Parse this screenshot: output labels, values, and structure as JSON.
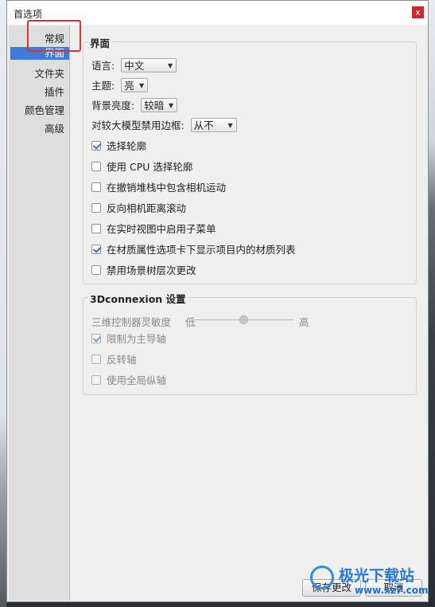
{
  "window": {
    "title": "首选项",
    "close_label": "x"
  },
  "sidebar": {
    "items": [
      {
        "label": "常规"
      },
      {
        "label": "界面",
        "selected": true
      },
      {
        "label": "文件夹"
      },
      {
        "label": "插件"
      },
      {
        "label": "颜色管理"
      },
      {
        "label": "高级"
      }
    ]
  },
  "interface": {
    "title": "界面",
    "language_label": "语言:",
    "language_value": "中文",
    "theme_label": "主题:",
    "theme_value": "亮",
    "brightness_label": "背景亮度:",
    "brightness_value": "较暗",
    "border_label": "对较大模型禁用边框:",
    "border_value": "从不",
    "checkboxes": [
      {
        "label": "选择轮廓",
        "checked": true
      },
      {
        "label": "使用 CPU 选择轮廓",
        "checked": false
      },
      {
        "label": "在撤销堆栈中包含相机运动",
        "checked": false
      },
      {
        "label": "反向相机距离滚动",
        "checked": false
      },
      {
        "label": "在实时视图中启用子菜单",
        "checked": false
      },
      {
        "label": "在材质属性选项卡下显示项目内的材质列表",
        "checked": true
      },
      {
        "label": "禁用场景树层次更改",
        "checked": false
      }
    ]
  },
  "connexion": {
    "title": "3Dconnexion 设置",
    "sensitivity_label": "三维控制器灵敏度",
    "low_label": "低",
    "high_label": "高",
    "sensitivity_level": 0.5,
    "checkboxes": [
      {
        "label": "限制为主导轴",
        "checked": true
      },
      {
        "label": "反转轴",
        "checked": false
      },
      {
        "label": "使用全局纵轴",
        "checked": false
      }
    ]
  },
  "buttons": {
    "save": "保存更改",
    "cancel": "取消"
  },
  "watermark": {
    "name": "极光下载站",
    "url": "www.xz7.com"
  },
  "colors": {
    "accent": "#3d7bd8",
    "highlight_box": "#e03030",
    "close": "#c8292a"
  }
}
